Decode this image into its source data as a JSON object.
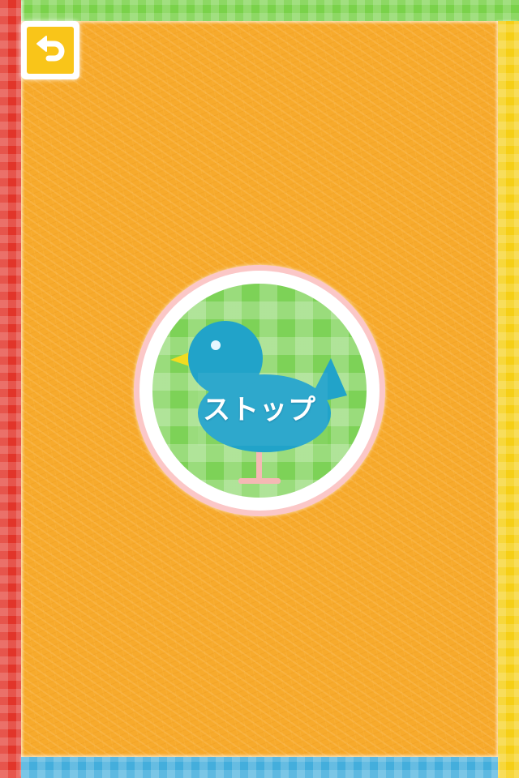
{
  "screen": {
    "colors": {
      "background": "#f7aa2c",
      "border_top": "#7ad24a",
      "border_left": "#e2352a",
      "border_right": "#f6cf16",
      "border_bottom": "#44aedc",
      "back_button": "#f9c519",
      "disc": "#7dd257",
      "bird": "#21a3c9",
      "ring_outer": "#fbc7c7"
    }
  },
  "back_button": {
    "icon": "undo-arrow-icon"
  },
  "stop_button": {
    "label": "ストップ",
    "icon": "bird-icon"
  }
}
